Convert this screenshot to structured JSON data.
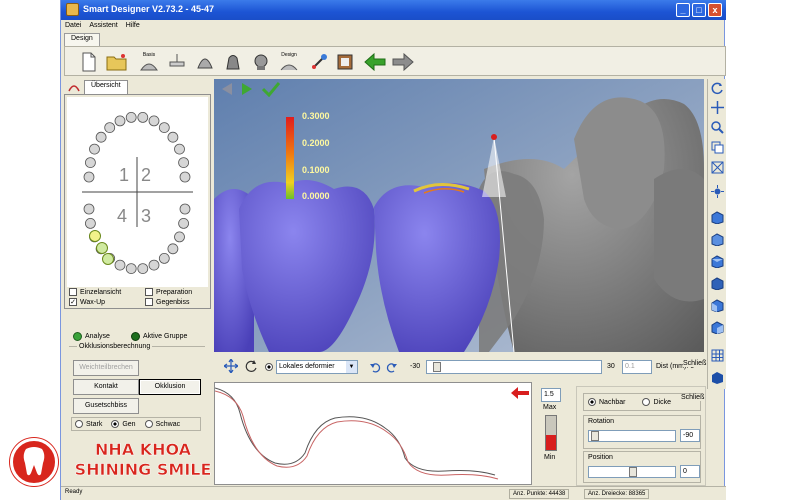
{
  "window": {
    "title": "Smart Designer V2.73.2 - 45-47",
    "minimize": "_",
    "maximize": "□",
    "close": "x"
  },
  "menu": [
    "Datei",
    "Assistent",
    "Hilfe"
  ],
  "toolbar": {
    "tab_label": "Design",
    "buttons": [
      {
        "icon": "new-document-icon",
        "label": ""
      },
      {
        "icon": "open-folder-icon",
        "label": ""
      },
      {
        "icon": "base-icon",
        "label": "Basis"
      },
      {
        "icon": "preparation-icon",
        "label": ""
      },
      {
        "icon": "tooth-insertion-icon",
        "label": ""
      },
      {
        "icon": "tooth-shape-icon",
        "label": ""
      },
      {
        "icon": "tooth-view-icon",
        "label": ""
      },
      {
        "icon": "design-icon",
        "label": "Design"
      },
      {
        "icon": "tools-icon",
        "label": ""
      },
      {
        "icon": "export-icon",
        "label": ""
      },
      {
        "icon": "back-arrow-icon",
        "label": ""
      },
      {
        "icon": "forward-arrow-icon",
        "label": ""
      }
    ]
  },
  "left_panel": {
    "tab_label": "Übersicht",
    "quadrants": [
      "1",
      "2",
      "4",
      "3"
    ],
    "checkboxes": [
      {
        "label": "Einzelansicht",
        "checked": false
      },
      {
        "label": "Preparation",
        "checked": false
      },
      {
        "label": "Wax-Up",
        "checked": true
      },
      {
        "label": "Gegenbiss",
        "checked": false
      }
    ]
  },
  "analysis": {
    "legend": [
      {
        "label": "Analyse",
        "color": "#3aa33a"
      },
      {
        "label": "Aktive Gruppe",
        "color": "#1d6e1d"
      }
    ],
    "group_title": "Okklusionsberechnung",
    "buttons": {
      "weichteile": "Weichteilbrechen",
      "kontakt": "Kontakt",
      "okklusion": "Okklusion",
      "gussbiss": "Gusetschbiss"
    },
    "strength": [
      {
        "label": "Stark",
        "selected": false
      },
      {
        "label": "Gen",
        "selected": true
      },
      {
        "label": "Schwac",
        "selected": false
      }
    ]
  },
  "viewport": {
    "scale": [
      "0.3000",
      "0.2000",
      "0.1000",
      "0.0000"
    ],
    "nav_left": "◀",
    "nav_right": "▶",
    "confirm": "✔"
  },
  "controls": {
    "mode_option": "Lokales deformier",
    "slider_min": "-30",
    "slider_max": "30",
    "step_value": "0.1",
    "dist_label": "Dist (mm): 0",
    "close_label": "Schließ"
  },
  "gauge": {
    "value": "1.5",
    "max_label": "Max",
    "min_label": "Min",
    "indicator_color": "#d81e1e"
  },
  "props": {
    "options": [
      {
        "label": "Nachbar",
        "selected": true
      },
      {
        "label": "Dicke",
        "selected": false
      }
    ],
    "rotation_label": "Rotation",
    "rotation_value": "-90",
    "position_label": "Position",
    "position_value": "0",
    "close_label": "Schließ"
  },
  "status": {
    "text": "Ready",
    "points": "Anz. Punkte: 44438",
    "triangles": "Anz. Dreiecke: 88365"
  },
  "watermark": {
    "logo_line1": "SHINING",
    "logo_line2": "SMILE",
    "line1": "NHA KHOA",
    "line2": "SHINING SMILE",
    "brand_color": "#d8261d"
  }
}
